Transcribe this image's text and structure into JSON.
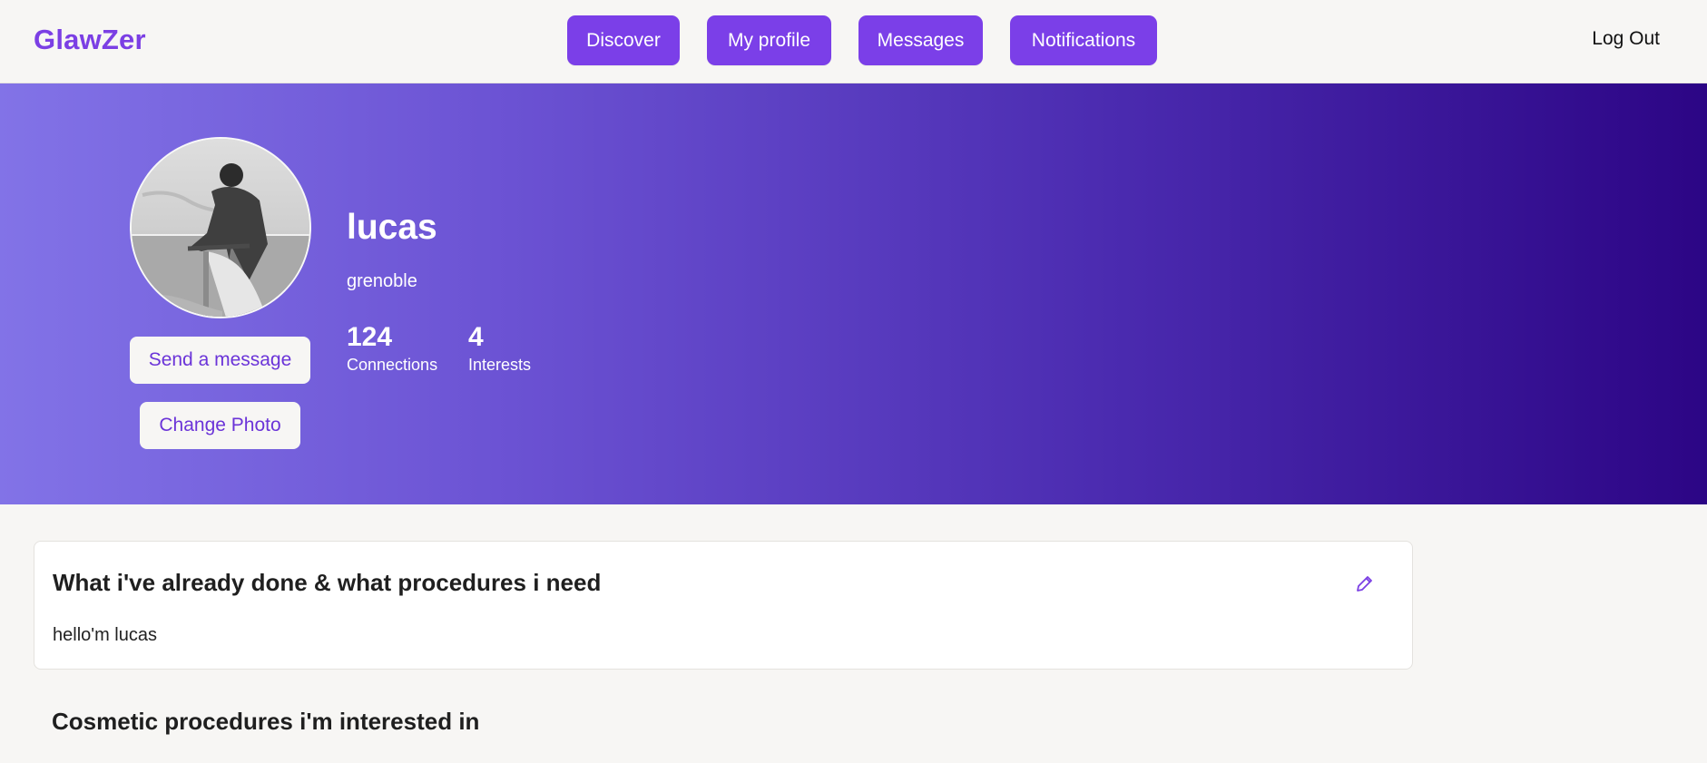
{
  "header": {
    "logo": "GlawZer",
    "nav": [
      {
        "label": "Discover"
      },
      {
        "label": "My profile"
      },
      {
        "label": "Messages"
      },
      {
        "label": "Notifications"
      }
    ],
    "logout_label": "Log Out"
  },
  "profile": {
    "name": "lucas",
    "city": "grenoble",
    "stats": [
      {
        "value": "124",
        "label": "Connections"
      },
      {
        "value": "4",
        "label": "Interests"
      }
    ],
    "send_message_label": "Send a message",
    "change_photo_label": "Change Photo"
  },
  "about_card": {
    "title": "What i've already done & what procedures i need",
    "body": "hello'm lucas",
    "edit_icon": "pencil-icon"
  },
  "interests_section": {
    "title": "Cosmetic procedures i'm interested in"
  },
  "colors": {
    "brand": "#7b3fe4",
    "nav_button": "#7b3fe8",
    "hero_start": "#8273e7",
    "hero_end": "#2c0585",
    "page_bg": "#f7f6f4"
  }
}
